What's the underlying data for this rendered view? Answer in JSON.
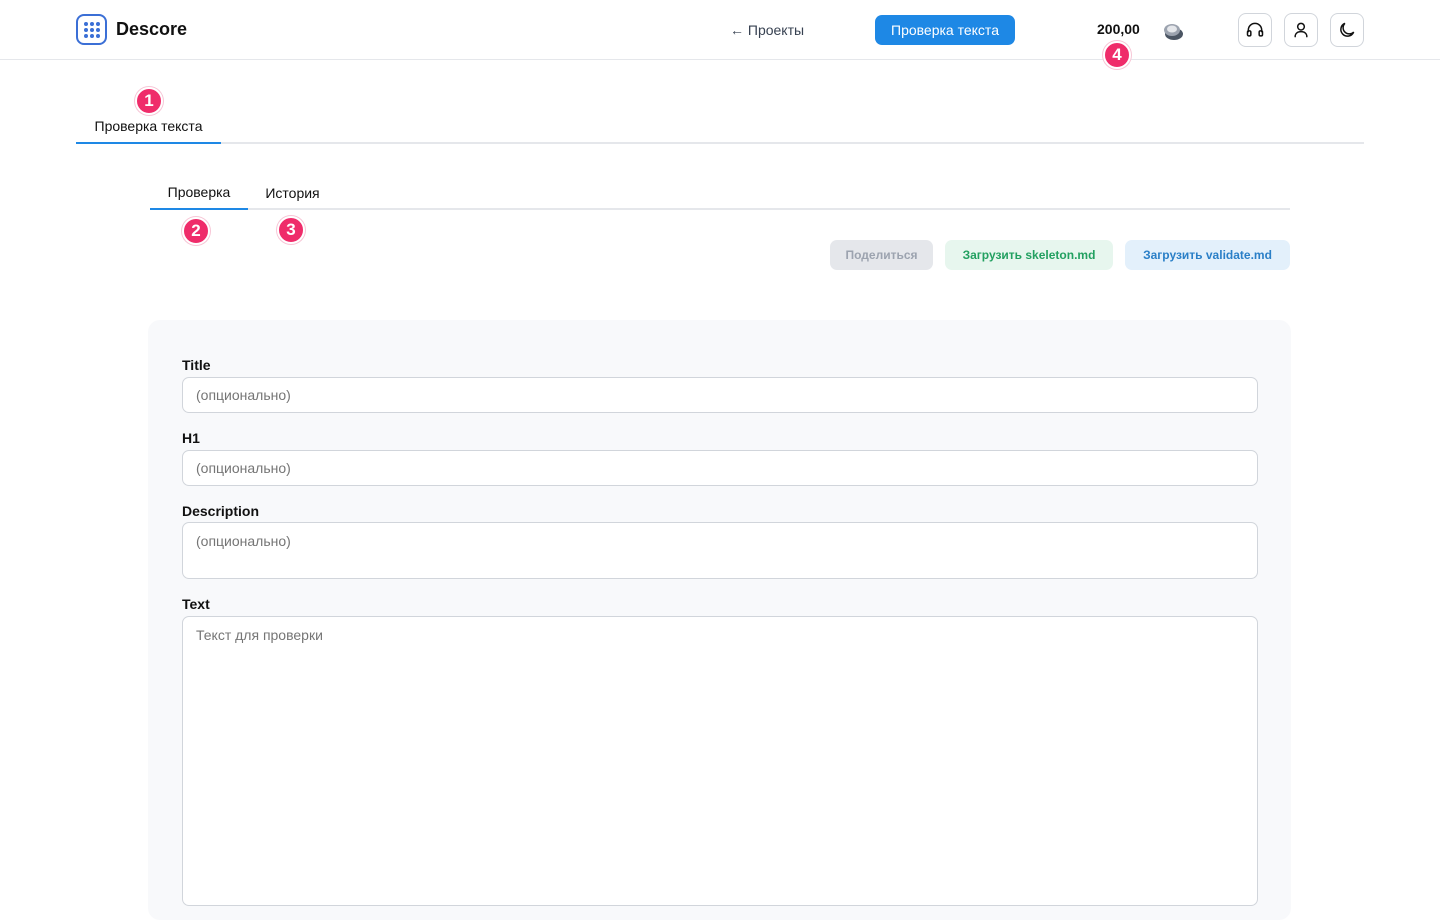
{
  "header": {
    "brand": "Descore",
    "back_label": "← Проекты",
    "primary_nav_label": "Проверка текста",
    "balance": "200,00",
    "icons": [
      "support-headset-icon",
      "user-icon",
      "moon-icon"
    ]
  },
  "badges": {
    "b1": "1",
    "b2": "2",
    "b3": "3",
    "b4": "4"
  },
  "top_tabs": [
    {
      "label": "Проверка текста",
      "active": true
    }
  ],
  "sub_tabs": [
    {
      "label": "Проверка",
      "active": true
    },
    {
      "label": "История",
      "active": false
    }
  ],
  "actions": {
    "share": "Поделиться",
    "upload_skeleton": "Загрузить skeleton.md",
    "upload_validate": "Загрузить validate.md"
  },
  "form": {
    "title_label": "Title",
    "title_placeholder": "(опционально)",
    "h1_label": "H1",
    "h1_placeholder": "(опционально)",
    "description_label": "Description",
    "description_placeholder": "(опционально)",
    "text_label": "Text",
    "text_placeholder": "Текст для проверки"
  },
  "colors": {
    "accent": "#1e88e5",
    "badge": "#ef2c6a",
    "success_text": "#22a060",
    "info_text": "#2a7fc7"
  }
}
